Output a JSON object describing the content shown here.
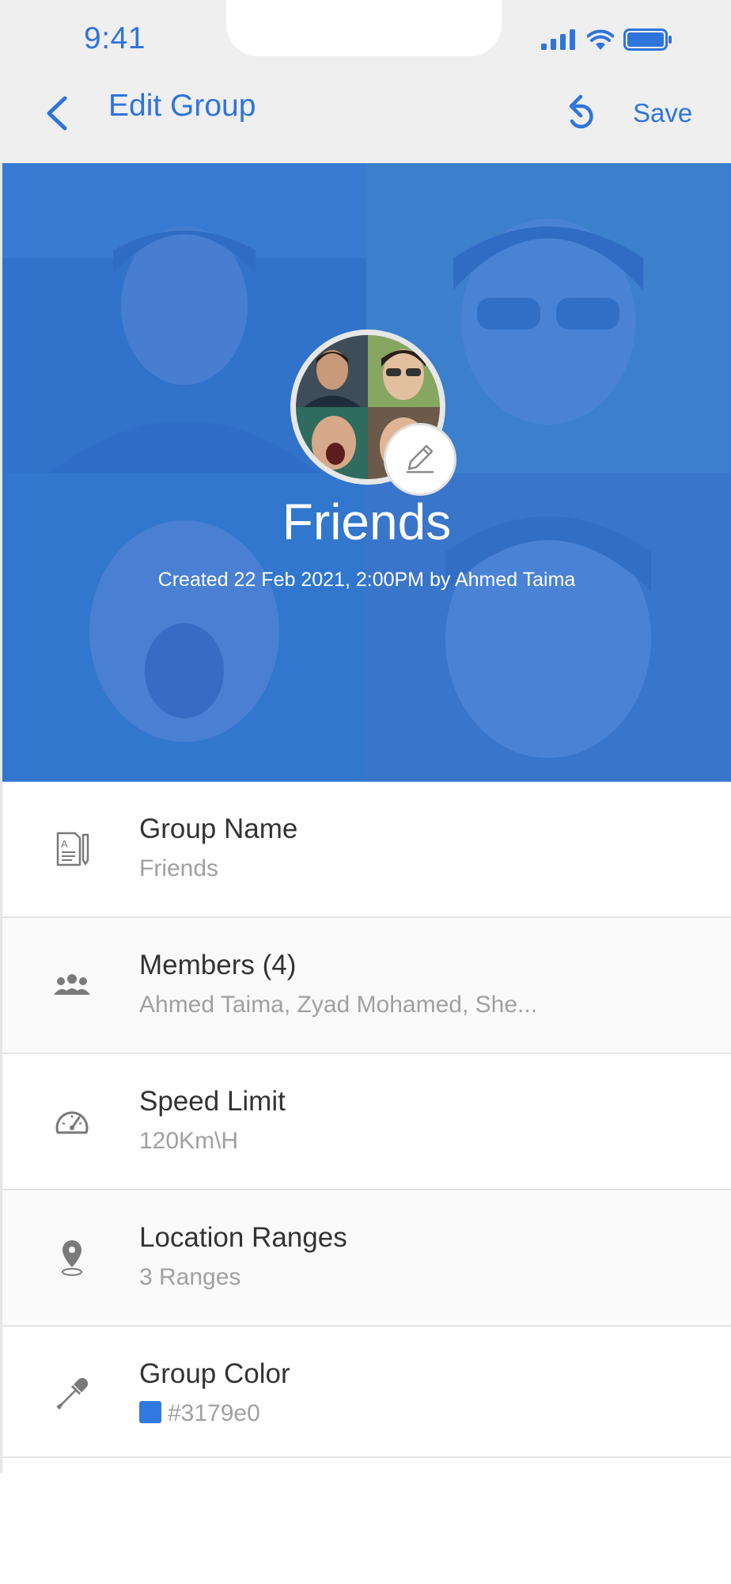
{
  "status_bar": {
    "time": "9:41",
    "icons": [
      "signal-icon",
      "wifi-icon",
      "battery-icon"
    ]
  },
  "nav": {
    "back_icon": "chevron-left-icon",
    "title": "Edit Group",
    "undo_icon": "undo-icon",
    "save_label": "Save"
  },
  "header": {
    "group_name": "Friends",
    "created_text": "Created 22 Feb 2021, 2:00PM by Ahmed Taima",
    "edit_icon": "pencil-icon",
    "background_color": "#3179e0"
  },
  "list": {
    "items": [
      {
        "icon": "document-edit-icon",
        "title": "Group Name",
        "value": "Friends"
      },
      {
        "icon": "members-icon",
        "title": "Members (4)",
        "value": "Ahmed Taima, Zyad Mohamed, She..."
      },
      {
        "icon": "speedometer-icon",
        "title": "Speed Limit",
        "value": "120Km\\H"
      },
      {
        "icon": "location-pin-icon",
        "title": "Location Ranges",
        "value": "3 Ranges"
      },
      {
        "icon": "eyedropper-icon",
        "title": "Group Color",
        "value": "#3179e0"
      }
    ]
  },
  "colors": {
    "accent": "#2f74da",
    "group_color": "#3179e0",
    "bar_background": "#efefef"
  }
}
